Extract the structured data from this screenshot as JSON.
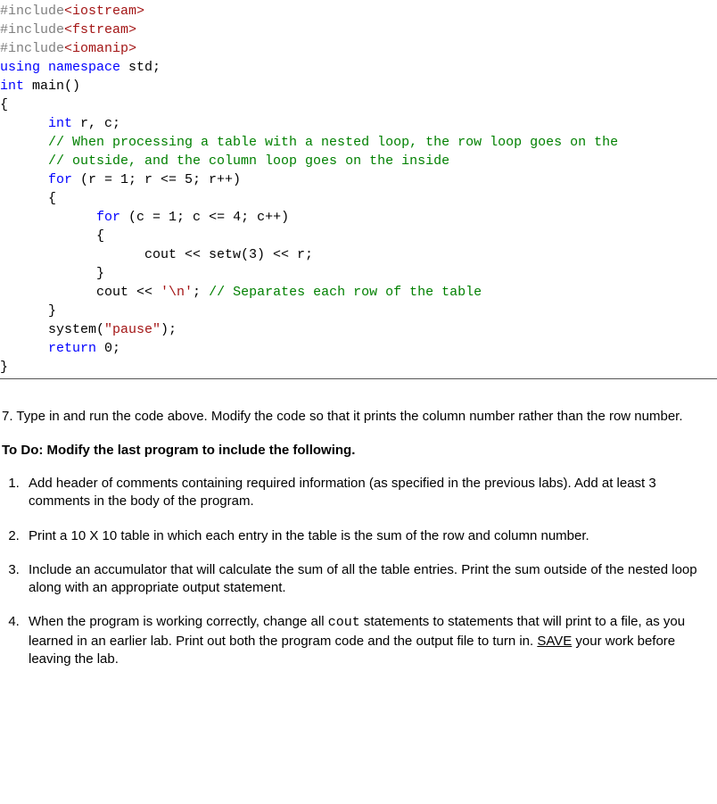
{
  "code": {
    "l01a": "#include",
    "l01b": "<iostream>",
    "l02a": "#include",
    "l02b": "<fstream>",
    "l03a": "#include",
    "l03b": "<iomanip>",
    "l04a": "using",
    "l04b": " ",
    "l04c": "namespace",
    "l04d": " std;",
    "l05a": "int",
    "l05b": " main()",
    "l06": "{",
    "l07a": "      ",
    "l07b": "int",
    "l07c": " r, c;",
    "l08": "      // When processing a table with a nested loop, the row loop goes on the",
    "l09": "      // outside, and the column loop goes on the inside",
    "l10a": "      ",
    "l10b": "for",
    "l10c": " (r = 1; r <= 5; r++)",
    "l11": "      {",
    "l12a": "            ",
    "l12b": "for",
    "l12c": " (c = 1; c <= 4; c++)",
    "l13": "            {",
    "l14a": "                  cout << setw(3) << r;",
    "l15": "            }",
    "l16a": "            cout << ",
    "l16b": "'\\n'",
    "l16c": "; ",
    "l16d": "// Separates each row of the table",
    "l17": "      }",
    "l18a": "      system(",
    "l18b": "\"pause\"",
    "l18c": ");",
    "l19a": "      ",
    "l19b": "return",
    "l19c": " 0;",
    "l20": "}"
  },
  "q7": "7. Type in and run the code above.  Modify the code so that it prints the column number rather than the row number.",
  "todo_heading": "To Do:  Modify the last program to include the following.",
  "tasks": {
    "t1": "Add header of comments containing required information (as specified in the previous labs).  Add at least 3 comments in the body of the program.",
    "t2": "Print a 10 X 10 table in which each entry in the table is the sum of the row and column number.",
    "t3": "Include an accumulator that will calculate the sum of all the table entries.  Print the sum outside of the nested loop along with an appropriate output statement.",
    "t4a": "When the program is working correctly, change all ",
    "t4b": "cout",
    "t4c": " statements to statements that will print to a file, as you learned in an earlier lab.  Print out both the program code and the output file to turn in.  ",
    "t4d": "SAVE",
    "t4e": " your work before leaving the lab."
  }
}
